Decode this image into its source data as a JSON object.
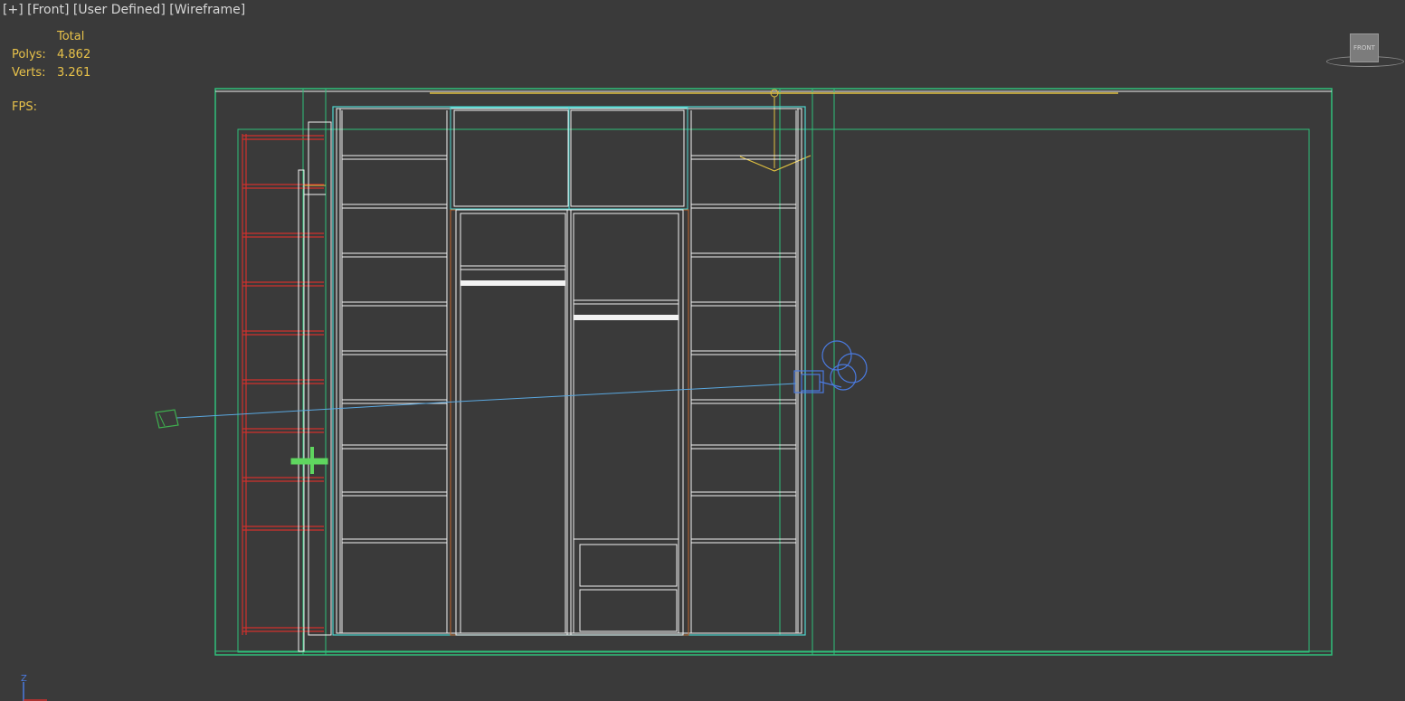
{
  "viewport": {
    "label_plus": "[+]",
    "label_view": "[Front]",
    "label_shading_mode": "[User Defined]",
    "label_display": "[Wireframe]"
  },
  "stats": {
    "header": "Total",
    "polys_label": "Polys:",
    "polys_value": "4.862",
    "verts_label": "Verts:",
    "verts_value": "3.261",
    "fps_label": "FPS:"
  },
  "viewcube": {
    "face_label": "FRONT"
  },
  "axis": {
    "z_label": "Z"
  },
  "colors": {
    "background": "#3a3a3a",
    "wireframe_white": "#f2f2f2",
    "wireframe_green": "#2fc07a",
    "wireframe_cyan": "#4fd6d0",
    "wireframe_red": "#d0302c",
    "wireframe_orange": "#c0642c",
    "wireframe_yellow": "#e0c040",
    "camera_blue": "#4a7ae0",
    "stats_text": "#e8c24a"
  }
}
